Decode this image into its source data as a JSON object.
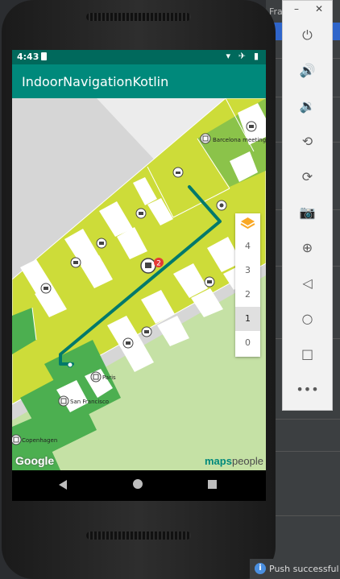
{
  "ide": {
    "window_fragment": "Fra"
  },
  "status_bar": {
    "time": "4:43",
    "icons": "▾ ✈ ▮"
  },
  "app": {
    "title": "IndoorNavigationKotlin"
  },
  "map": {
    "rooms": {
      "barcelona": "Barcelona meeting",
      "paris": "Paris",
      "san_francisco": "San Francisco",
      "copenhagen": "Copenhagen"
    },
    "marker_badge": "2",
    "route_color": "#00796b",
    "floor_bg": "#cddc39"
  },
  "floor_picker": {
    "layers_icon": "layers-icon",
    "floors": [
      "4",
      "3",
      "2",
      "1",
      "0"
    ],
    "selected_floor": "1"
  },
  "attribution": {
    "google": "Google",
    "mapspeople_a": "maps",
    "mapspeople_b": "people"
  },
  "emulator_toolbar": {
    "minimize": "–",
    "close": "✕",
    "power": "⏻",
    "volume_up": "🔊",
    "volume_down": "🔉",
    "rotate_left": "⟲",
    "rotate_right": "⟳",
    "camera": "📷",
    "zoom": "⊕",
    "back": "◁",
    "home": "○",
    "overview": "□",
    "more": "•••"
  },
  "notification": {
    "icon": "i",
    "text": "Push successful"
  }
}
